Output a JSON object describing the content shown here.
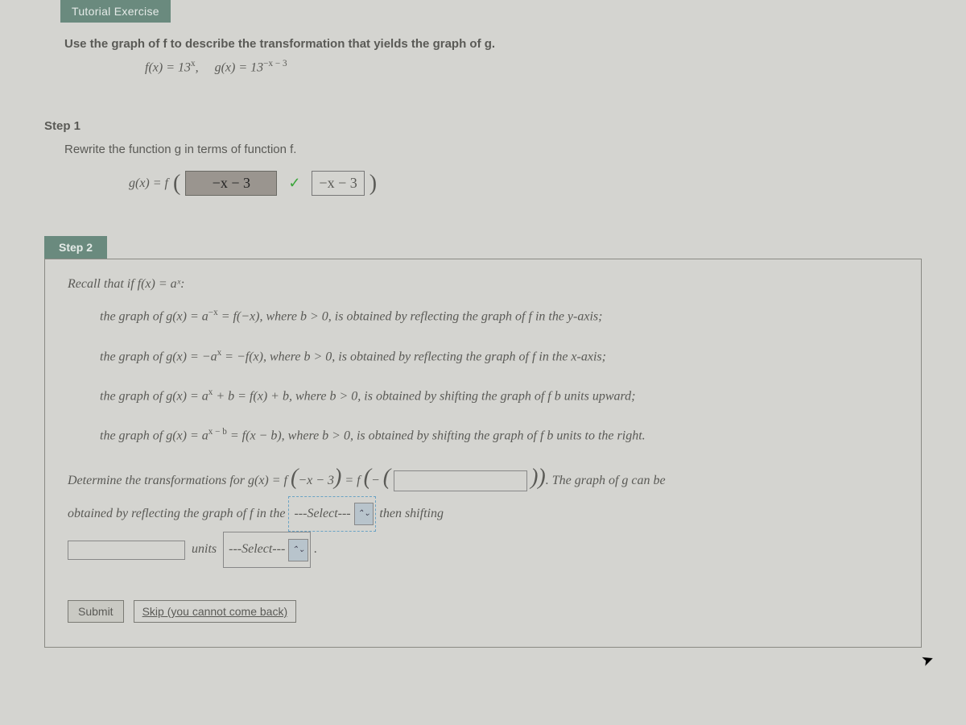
{
  "header": {
    "tab": "Tutorial Exercise"
  },
  "intro": {
    "prompt": "Use the graph of f to describe the transformation that yields the graph of g.",
    "fx_label": "f(x) = 13",
    "fx_exp": "x",
    "gx_label": "g(x) = 13",
    "gx_exp": "−x − 3",
    "comma": ","
  },
  "step1": {
    "label": "Step 1",
    "text": "Rewrite the function g in terms of function f.",
    "lhs": "g(x) = f",
    "answer_value": "−x − 3",
    "hint_value": "−x − 3"
  },
  "step2": {
    "label": "Step 2",
    "recall": "Recall that if  f(x) = aˣ:",
    "rule1a": "the graph of  g(x) = a",
    "rule1exp": "−x",
    "rule1b": " = f(−x),  where  b > 0,  is obtained by reflecting the graph of f in the y-axis;",
    "rule2a": "the graph of  g(x) = −a",
    "rule2exp": "x",
    "rule2b": " = −f(x),  where  b > 0,  is obtained by reflecting the graph of f in the x-axis;",
    "rule3a": "the graph of  g(x) = a",
    "rule3exp": "x",
    "rule3b": " + b = f(x) + b,  where  b > 0,  is obtained by shifting the graph of f b units upward;",
    "rule4a": "the graph of  g(x) = a",
    "rule4exp": "x − b",
    "rule4b": " = f(x − b),  where  b > 0,  is obtained by shifting the graph of f b units to the right.",
    "determine_a": "Determine the transformations for  g(x) = f",
    "inner1": "−x − 3",
    "eq": " = f",
    "minus": "−",
    "tail1": ".  The graph of g can be",
    "line2a": "obtained by reflecting the graph of f in the",
    "select1": "---Select---",
    "line2b": "then shifting",
    "units": "units",
    "select2": "---Select---",
    "period": "."
  },
  "footer": {
    "submit": "Submit",
    "skip": "Skip (you cannot come back)"
  }
}
